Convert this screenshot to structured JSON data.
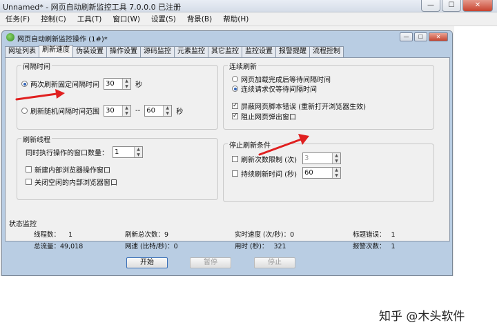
{
  "window": {
    "title": "Unnamed* - 网页自动刷新监控工具 7.0.0.0  已注册",
    "minimize": "—",
    "maximize": "☐",
    "close": "✕"
  },
  "menu": [
    "任务(F)",
    "控制(C)",
    "工具(T)",
    "窗口(W)",
    "设置(S)",
    "背景(B)",
    "帮助(H)"
  ],
  "child": {
    "title": "网页自动刷新监控操作  (1#)*"
  },
  "tabs": [
    "网址列表",
    "刷新速度",
    "伪装设置",
    "操作设置",
    "源码监控",
    "元素监控",
    "其它监控",
    "监控设置",
    "报警提醒",
    "流程控制"
  ],
  "interval": {
    "legend": "间隔时间",
    "fixed_label": "两次刷新固定间隔时间",
    "fixed_value": "30",
    "fixed_unit": "秒",
    "random_label": "刷新随机间隔时间范围",
    "random_min": "30",
    "random_sep": "--",
    "random_max": "60",
    "random_unit": "秒"
  },
  "continuous": {
    "legend": "连续刷新",
    "opt1": "网页加载完成后等待间隔时间",
    "opt2": "连续请求仅等待间隔时间",
    "check1": "屏蔽网页脚本错误 (重新打开浏览器生效)",
    "check2": "阻止网页弹出窗口"
  },
  "threads": {
    "legend": "刷新线程",
    "count_label": "同时执行操作的窗口数量：",
    "count_value": "1",
    "check1": "新建内部浏览器操作窗口",
    "check2": "关闭空闲的内部浏览器窗口"
  },
  "stop": {
    "legend": "停止刷新条件",
    "check1": "刷新次数限制 (次)",
    "value1": "3",
    "check2": "持续刷新时间 (秒)",
    "value2": "60"
  },
  "status": {
    "title": "状态监控",
    "items": [
      {
        "label": "线程数：",
        "value": "1"
      },
      {
        "label": "刷新总次数：",
        "value": "9"
      },
      {
        "label": "实时速度 (次/秒)：",
        "value": "0"
      },
      {
        "label": "标题错误：",
        "value": "1"
      },
      {
        "label": "总流量：",
        "value": "49,018"
      },
      {
        "label": "网速 (比特/秒)：",
        "value": "0"
      },
      {
        "label": "用时 (秒)：",
        "value": "321"
      },
      {
        "label": "报警次数：",
        "value": "1"
      }
    ]
  },
  "buttons": {
    "start": "开始",
    "pause": "暂停",
    "stop": "停止"
  },
  "watermark": "知乎 @木头软件"
}
